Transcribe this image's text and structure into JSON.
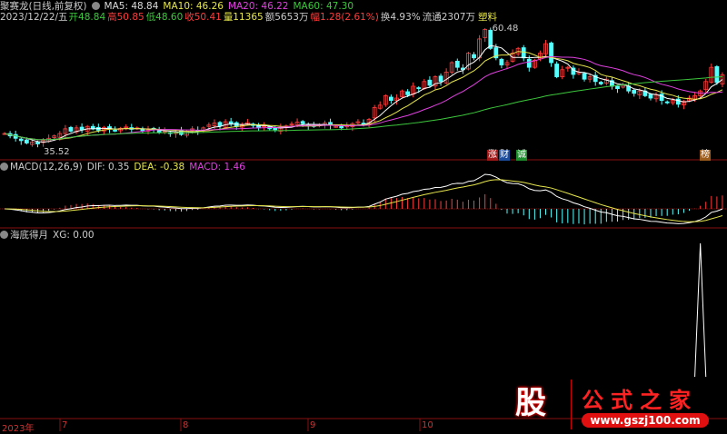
{
  "header": {
    "stock_name": "聚赛龙(日线,前复权)",
    "ma5": "MA5: 48.84",
    "ma10": "MA10: 46.26",
    "ma20": "MA20: 46.22",
    "ma60": "MA60: 47.30",
    "date": "2023/12/22/五",
    "open": "开48.84",
    "high": "高50.85",
    "low": "低48.60",
    "close": "收50.41",
    "volume": "量11365",
    "amount": "额5653万",
    "change": "幅1.28(2.61%)",
    "turnover": "换4.93%",
    "float": "流通2307万",
    "sector": "塑料"
  },
  "price_labels": {
    "high": "60.48",
    "low": "35.52"
  },
  "badges": [
    "涨",
    "财",
    "诚",
    "榜"
  ],
  "macd": {
    "title": "MACD(12,26,9)",
    "dif": "DIF: 0.35",
    "dea": "DEA: -0.38",
    "macd": "MACD: 1.46"
  },
  "indicator": {
    "title": "海底得月",
    "xg": "XG: 0.00"
  },
  "time_axis": [
    "2023年",
    "7",
    "8",
    "9",
    "10"
  ],
  "logo": {
    "text": "股",
    "name": "公式之家",
    "url": "www.gszj100.com"
  },
  "colors": {
    "up": "#ff3c3c",
    "down": "#54ffff",
    "ma5": "#ffffff",
    "ma10": "#e6e64c",
    "ma20": "#e040e0",
    "ma60": "#3cc83c"
  },
  "chart_data": {
    "type": "candlestick",
    "ylim": [
      35.52,
      60.48
    ],
    "closes": [
      38,
      37.5,
      37,
      36.5,
      36,
      36.2,
      35.8,
      36.5,
      37,
      37.5,
      38,
      39,
      38.5,
      39.2,
      38.8,
      39.5,
      39,
      38.7,
      39.3,
      39,
      38.6,
      39.1,
      39.4,
      38.9,
      39.2,
      38.5,
      38.8,
      39,
      38.2,
      38.5,
      38,
      38.3,
      37.8,
      38.5,
      39,
      38.6,
      39.2,
      39.8,
      40.2,
      39.6,
      40.5,
      40,
      39.5,
      39.8,
      40.3,
      39.7,
      39.2,
      39.6,
      39,
      38.8,
      39.3,
      39.6,
      40,
      40.4,
      40.1,
      39.7,
      39.5,
      39.9,
      40.2,
      39.8,
      39.5,
      39.2,
      39.6,
      40.1,
      40.5,
      40,
      41,
      43.5,
      44,
      46,
      45,
      45.5,
      47,
      46.2,
      48,
      47.5,
      49,
      48.2,
      50,
      49,
      51,
      53,
      52,
      51.5,
      55,
      54,
      58,
      60,
      56,
      54,
      52.5,
      53,
      55,
      56,
      54,
      52,
      53.5,
      55,
      57,
      53,
      50,
      51.5,
      52,
      50.5,
      51,
      49.5,
      50,
      49,
      48.5,
      49.5,
      48,
      47.5,
      48.2,
      47,
      46.5,
      47,
      46,
      45.5,
      46.2,
      45,
      44.5,
      45,
      44.2,
      44.8,
      45.5,
      46,
      47,
      49,
      52,
      48.8,
      50.4
    ],
    "xg_signal_index": 126
  }
}
